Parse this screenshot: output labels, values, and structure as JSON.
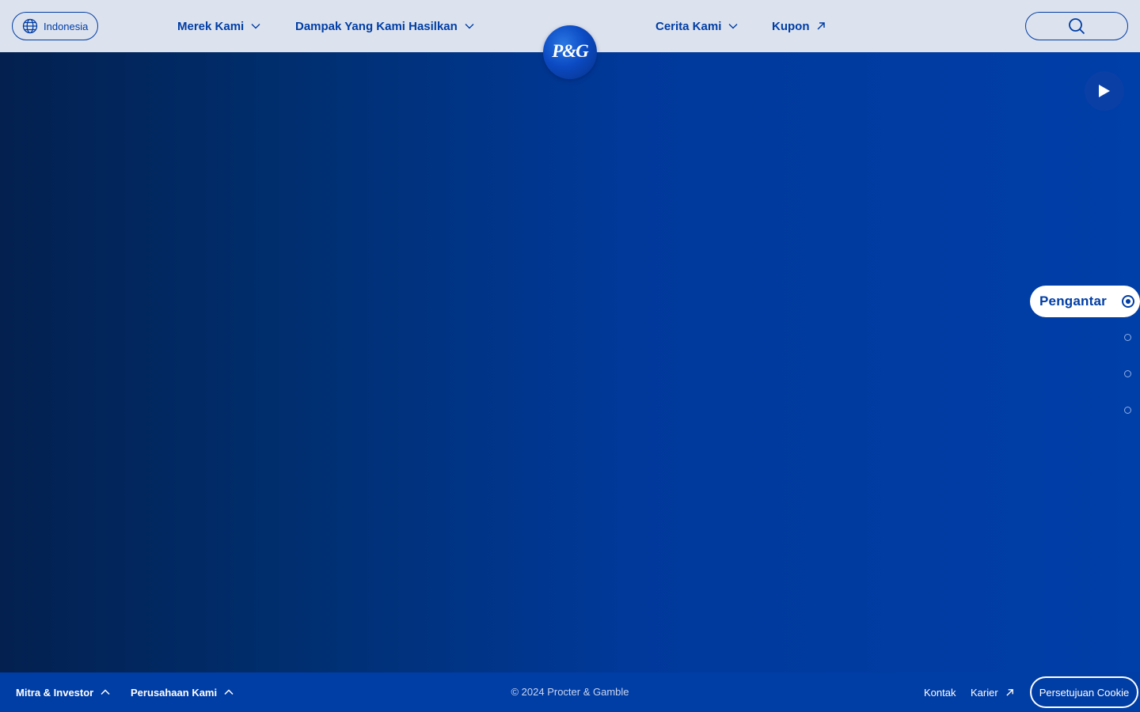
{
  "header": {
    "language_label": "Indonesia",
    "nav": [
      {
        "label": "Merek Kami",
        "icon": "chevron-down-icon"
      },
      {
        "label": "Dampak Yang Kami Hasilkan",
        "icon": "chevron-down-icon"
      },
      {
        "label": "Cerita Kami",
        "icon": "chevron-down-icon"
      },
      {
        "label": "Kupon",
        "icon": "external-arrow-icon"
      }
    ],
    "search_icon": "search-icon"
  },
  "logo": {
    "text": "P&G"
  },
  "hero": {
    "play_icon": "play-icon",
    "section_nav": {
      "active_label": "Pengantar",
      "total_sections": 4,
      "active_index": 0
    }
  },
  "footer": {
    "left_links": [
      {
        "label": "Mitra & Investor",
        "icon": "chevron-up-icon"
      },
      {
        "label": "Perusahaan Kami",
        "icon": "chevron-up-icon"
      }
    ],
    "copyright": "© 2024 Procter & Gamble",
    "right_links": [
      {
        "label": "Kontak"
      },
      {
        "label": "Karier",
        "icon": "external-arrow-icon"
      }
    ],
    "cookie_button": "Persetujuan Cookie"
  },
  "colors": {
    "brand_blue": "#003da5",
    "header_bg": "#dde3ee",
    "hero_dark": "#03204f",
    "white": "#ffffff"
  }
}
